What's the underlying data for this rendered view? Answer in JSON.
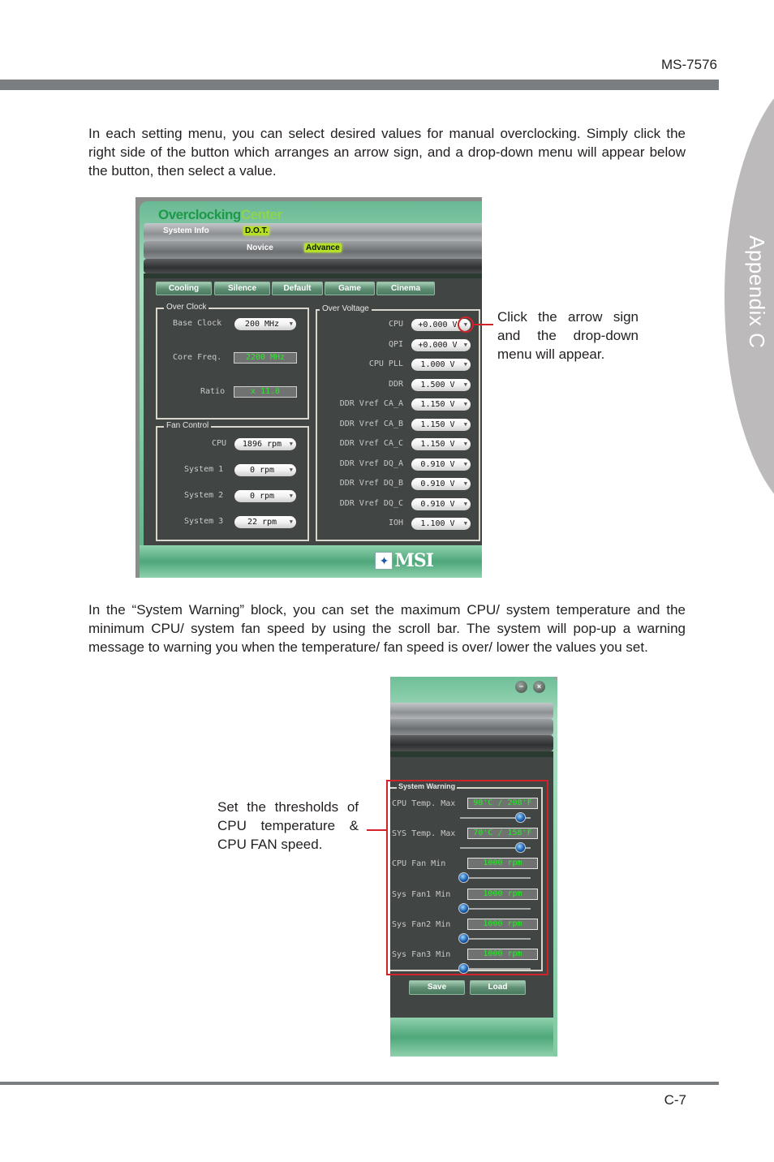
{
  "header": {
    "model_code": "MS-7576"
  },
  "side_tab": {
    "label": "Appendix C"
  },
  "footer": {
    "page_number": "C-7"
  },
  "paragraphs": {
    "intro": "In each setting menu, you can select desired values for manual overclocking. Simply click the right side of the button which arranges an arrow sign, and a drop-down menu will appear below the button, then select a value.",
    "system_warning": "In the “System Warning” block, you can set the maximum CPU/ system  temperature and the minimum CPU/ system fan speed by using the scroll bar. The system will pop-up a warning message to warning you when the temperature/ fan speed is over/ lower the values you set."
  },
  "callouts": {
    "dropdown": "Click the arrow sign and the drop-down menu will appear.",
    "thresholds": "Set the thresholds of CPU temperature & CPU FAN speed."
  },
  "oc_window": {
    "title_part1": "Overclocking",
    "title_part2": "Center",
    "nav": {
      "system_info": "System Info",
      "dot": "D.O.T.",
      "novice": "Novice",
      "advance": "Advance"
    },
    "presets": [
      "Cooling",
      "Silence",
      "Default",
      "Game",
      "Cinema"
    ],
    "over_clock": {
      "title": "Over Clock",
      "base_clock": {
        "label": "Base Clock",
        "value": "200 MHz"
      },
      "core_freq": {
        "label": "Core Freq.",
        "value": "2200 MHz"
      },
      "ratio": {
        "label": "Ratio",
        "value": "x 11.0"
      }
    },
    "fan_control": {
      "title": "Fan Control",
      "rows": [
        {
          "label": "CPU",
          "value": "1896 rpm"
        },
        {
          "label": "System 1",
          "value": "0 rpm"
        },
        {
          "label": "System 2",
          "value": "0 rpm"
        },
        {
          "label": "System 3",
          "value": "22 rpm"
        }
      ]
    },
    "over_voltage": {
      "title": "Over Voltage",
      "rows": [
        {
          "label": "CPU",
          "value": "+0.000 V"
        },
        {
          "label": "QPI",
          "value": "+0.000 V"
        },
        {
          "label": "CPU PLL",
          "value": "1.000 V"
        },
        {
          "label": "DDR",
          "value": "1.500 V"
        },
        {
          "label": "DDR Vref CA_A",
          "value": "1.150 V"
        },
        {
          "label": "DDR Vref CA_B",
          "value": "1.150 V"
        },
        {
          "label": "DDR Vref CA_C",
          "value": "1.150 V"
        },
        {
          "label": "DDR Vref DQ_A",
          "value": "0.910 V"
        },
        {
          "label": "DDR Vref DQ_B",
          "value": "0.910 V"
        },
        {
          "label": "DDR Vref DQ_C",
          "value": "0.910 V"
        },
        {
          "label": "IOH",
          "value": "1.100 V"
        }
      ]
    },
    "logo": "MSI"
  },
  "sw_window": {
    "title": "System Warning",
    "rows": [
      {
        "label": "CPU Temp. Max",
        "value": "98'C / 208'F",
        "slider_fraction": 0.85
      },
      {
        "label": "SYS Temp. Max",
        "value": "70'C / 158'F",
        "slider_fraction": 0.85
      },
      {
        "label": "CPU Fan Min",
        "value": "1000 rpm",
        "slider_fraction": 0.05
      },
      {
        "label": "Sys Fan1 Min",
        "value": "1000 rpm",
        "slider_fraction": 0.05
      },
      {
        "label": "Sys Fan2 Min",
        "value": "1000 rpm",
        "slider_fraction": 0.05
      },
      {
        "label": "Sys Fan3 Min",
        "value": "1000 rpm",
        "slider_fraction": 0.05
      }
    ],
    "save_label": "Save",
    "load_label": "Load",
    "minimize_icon": "−",
    "close_icon": "×"
  },
  "colors": {
    "highlight": "#d2232a",
    "readout_text": "#2ee82e",
    "accent_green": "#b6e028"
  }
}
